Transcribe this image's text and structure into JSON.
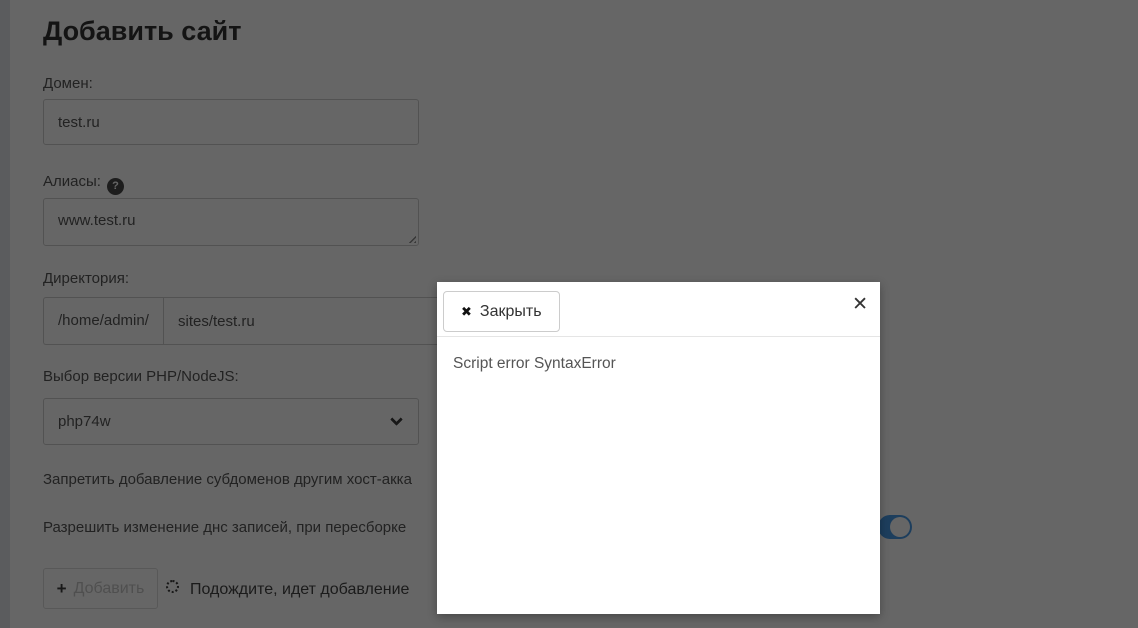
{
  "page": {
    "title": "Добавить сайт",
    "form": {
      "domain": {
        "label": "Домен:",
        "value": "test.ru"
      },
      "aliases": {
        "label": "Алиасы:",
        "value": "www.test.ru",
        "help_glyph": "?"
      },
      "directory": {
        "label": "Директория:",
        "prefix": "/home/admin/",
        "value": "sites/test.ru"
      },
      "php_version": {
        "label": "Выбор версии PHP/NodeJS:",
        "selected": "php74w"
      },
      "option_subdomains": {
        "label": "Запретить добавление субдоменов другим хост-акка"
      },
      "option_dns": {
        "label": "Разрешить изменение днс записей, при пересборке",
        "toggle_state": "on"
      },
      "submit_button": {
        "label": "Добавить",
        "plus_glyph": "+",
        "disabled": true
      },
      "progress": {
        "label": "Подождите, идет добавление"
      }
    }
  },
  "modal": {
    "close_button": {
      "label": "Закрыть",
      "x_glyph": "✖"
    },
    "corner_close_glyph": "✕",
    "body_text": "Script error SyntaxError"
  },
  "colors": {
    "toggle_on": "#4a9ce8",
    "overlay": "rgba(0,0,0,0.6)",
    "left_strip": "#e3e5eb",
    "modal_bg": "#ffffff"
  }
}
